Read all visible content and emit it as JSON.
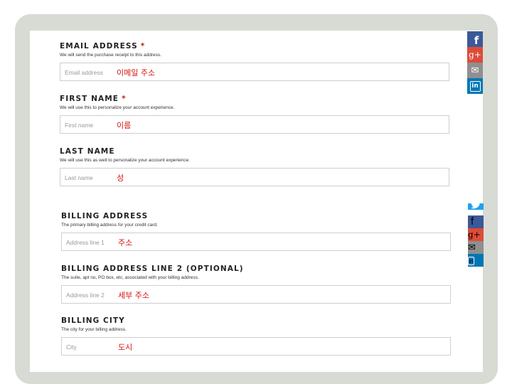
{
  "form": {
    "fields": [
      {
        "label": "EMAIL ADDRESS",
        "required": "*",
        "help": "We will send the purchase receipt to this address.",
        "placeholder": "Email address",
        "annotation": "이메일 주소"
      },
      {
        "label": "FIRST NAME",
        "required": "*",
        "help": "We will use this to personalize your account experience.",
        "placeholder": "First name",
        "annotation": "이름"
      },
      {
        "label": "LAST NAME",
        "help": "We will use this as well to personalize your account experience.",
        "placeholder": "Last name",
        "annotation": "성"
      },
      {
        "label": "BILLING ADDRESS",
        "help": "The primary billing address for your credit card.",
        "placeholder": "Address line 1",
        "annotation": "주소"
      },
      {
        "label": "BILLING ADDRESS LINE 2 (OPTIONAL)",
        "help": "The suite, apt no, PO box, etc, associated with your billing address.",
        "placeholder": "Address line 2",
        "annotation": "세부 주소"
      },
      {
        "label": "BILLING CITY",
        "help": "The city for your billing address.",
        "placeholder": "City",
        "annotation": "도시"
      }
    ]
  },
  "share_bar": {
    "icons": [
      "facebook-icon",
      "google-plus-icon",
      "email-icon",
      "linkedin-icon",
      "twitter-icon"
    ],
    "facebook_glyph": "f",
    "google_plus_glyph": "g+",
    "email_glyph": "✉",
    "linkedin_glyph": "in",
    "twitter_glyph": "🐦"
  },
  "colors": {
    "facebook": "#3b5998",
    "google_plus": "#dd4b39",
    "email": "#8f8f8f",
    "linkedin": "#0077b5",
    "twitter": "#1da1f2",
    "annotation": "#d8140f",
    "required": "#c0201a"
  }
}
